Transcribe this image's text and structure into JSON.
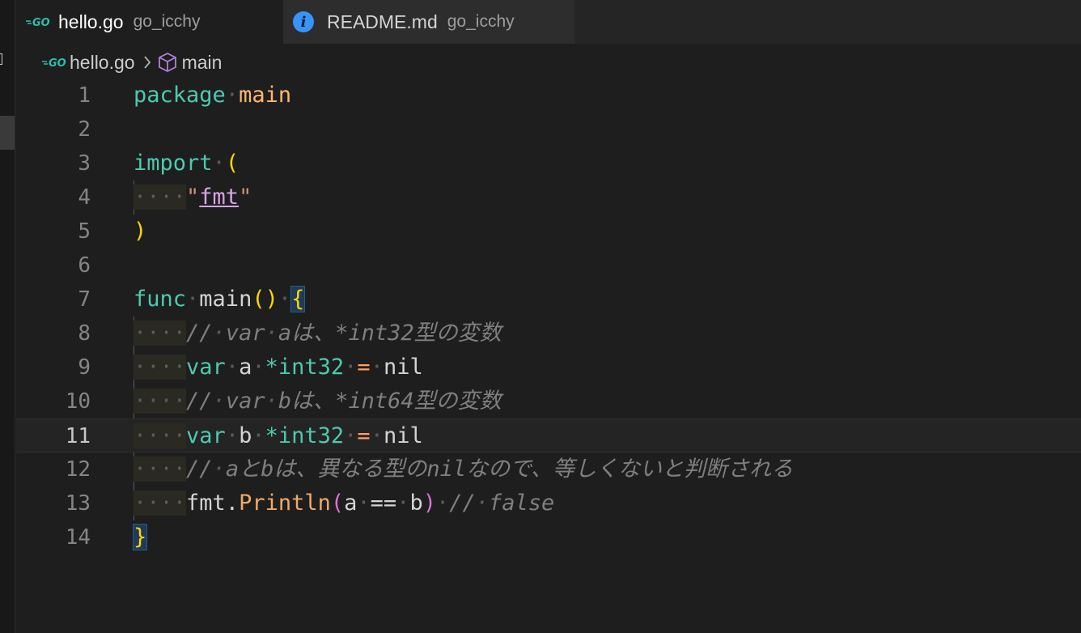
{
  "tabs": [
    {
      "name": "hello.go",
      "dir": "go_icchy",
      "icon": "go-icon",
      "active": true
    },
    {
      "name": "README.md",
      "dir": "go_icchy",
      "icon": "info-icon",
      "active": false
    }
  ],
  "breadcrumb": {
    "file": "hello.go",
    "symbol": "main"
  },
  "current_line": 11,
  "line_numbers": [
    "1",
    "2",
    "3",
    "4",
    "5",
    "6",
    "7",
    "8",
    "9",
    "10",
    "11",
    "12",
    "13",
    "14"
  ],
  "code": {
    "l1_kw": "package",
    "l1_name": "main",
    "l3_kw": "import",
    "l3_paren": "(",
    "l4_str_open": "\"",
    "l4_str_val": "fmt",
    "l4_str_close": "\"",
    "l5_paren": ")",
    "l7_kw": "func",
    "l7_name": "main",
    "l7_parens": "()",
    "l7_brace": "{",
    "l8_comment_pre": "//",
    "l8_comment_a": "var",
    "l8_comment_b": "aは、*int32型の変数",
    "l9_kw": "var",
    "l9_ident": "a",
    "l9_type": "*int32",
    "l9_op": "=",
    "l9_val": "nil",
    "l10_comment_pre": "//",
    "l10_comment_a": "var",
    "l10_comment_b": "bは、*int64型の変数",
    "l11_kw": "var",
    "l11_ident": "b",
    "l11_type": "*int32",
    "l11_op": "=",
    "l11_val": "nil",
    "l12_comment_pre": "//",
    "l12_comment_b": "aとbは、異なる型のnilなので、等しくないと判断される",
    "l13_pkg": "fmt.",
    "l13_fn": "Println",
    "l13_open": "(",
    "l13_a": "a",
    "l13_op": "==",
    "l13_b": "b",
    "l13_close": ")",
    "l13_comment_pre": "//",
    "l13_comment_b": "false",
    "l14_brace": "}"
  },
  "colors": {
    "background": "#1e1e1e",
    "keyword": "#4ec9b0",
    "bracket": "#ffd700",
    "comment": "#7f7f7f",
    "info_icon": "#3794ff"
  }
}
